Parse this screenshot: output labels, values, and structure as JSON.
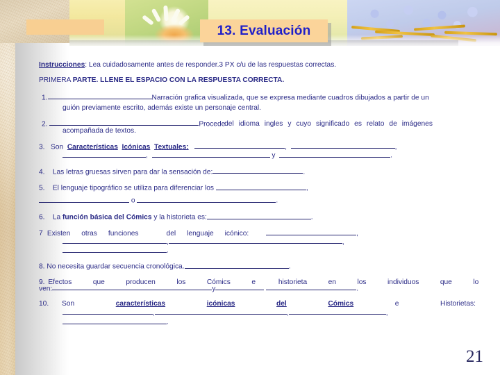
{
  "slide": {
    "title": "13. Evaluación",
    "page_number": "21",
    "title_box_color": "#fbd49a",
    "title_text_color": "#2020c8",
    "body_text_color": "#2a2a86"
  },
  "instructions": {
    "label": "Instrucciones",
    "colon": ":",
    "text": " Lea cuidadosamente antes de responder.3 PX  c/u de las respuestas correctas.",
    "part_prefix": "PRIMERA ",
    "part_bold": "PARTE. LLENE EL ESPACIO CON LA RESPUESTA CORRECTA."
  },
  "questions": {
    "q1": {
      "num": "1.",
      "line1": "Narración grafica visualizada, que se expresa mediante cuadros dibujados a partir de un",
      "line2": "guión previamente escrito, además existe un personaje central."
    },
    "q2": {
      "num": "2.",
      "w1": "Procede",
      "w2": "del",
      "w3": "idioma",
      "w4": "ingles",
      "w5": "y",
      "w6": "cuyo",
      "w7": "significado",
      "w8": "es",
      "w9": "relato",
      "w10": "de",
      "w11": "imágenes",
      "line2": "acompañada de textos."
    },
    "q3": {
      "num": "3.",
      "son": "Son",
      "t1": "Características",
      "t2": "Icónicas",
      "t3": "Textuales:",
      "comma": ",",
      "y": "y",
      "period": "."
    },
    "q4": {
      "num": "4.",
      "text": "Las letras gruesas sirven para dar la sensación de:",
      "period": "."
    },
    "q5": {
      "num": "5.",
      "text": "El lenguaje tipográfico se utiliza para diferenciar los",
      "comma": ",",
      "o": "o",
      "period": "."
    },
    "q6": {
      "num": "6.",
      "la": "La ",
      "bold": "función básica del Cómics",
      "rest": " y la historieta es:",
      "period": "."
    },
    "q7": {
      "num": "7",
      "w1": "Existen",
      "w2": "otras",
      "w3": "funciones",
      "w4": "del",
      "w5": "lenguaje",
      "w6": "icónico:",
      "comma": ",",
      "period": "."
    },
    "q8": {
      "num": "8.",
      "text": "No necesita guardar secuencia cronológica.",
      "period": "."
    },
    "q9": {
      "num": "9.",
      "w1": "Efectos",
      "w2": "que",
      "w3": "producen",
      "w4": "los",
      "w5": "Cómics",
      "w6": "e",
      "w7": "historieta",
      "w8": "en",
      "w9": "los",
      "w10": "individuos",
      "w11": "que",
      "w12": "lo",
      "line2_lead": "ven:",
      "y": "y",
      "period": "."
    },
    "q10": {
      "num": "10.",
      "son": "Son",
      "t1": "características",
      "t2": "icónicas",
      "t3": "del",
      "t4": "Cómics",
      "e": "e",
      "tail": "Historietas:",
      "comma": ",",
      "period": "."
    }
  }
}
